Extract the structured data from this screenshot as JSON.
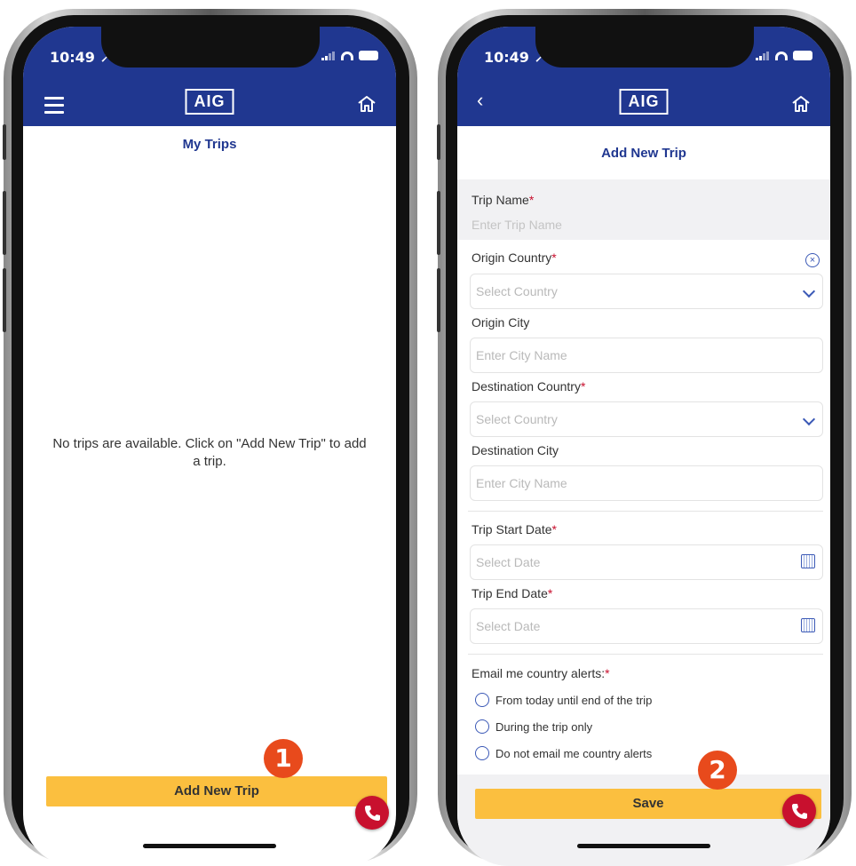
{
  "left_phone": {
    "status": {
      "time": "10:49 ➚"
    },
    "nav": {
      "logo": "AIG"
    },
    "title": "My Trips",
    "empty_message": "No trips are available. Click on \"Add New Trip\" to add a trip.",
    "add_button": "Add New Trip",
    "step_badge": "1"
  },
  "right_phone": {
    "status": {
      "time": "10:49 ➚"
    },
    "nav": {
      "back": "‹",
      "logo": "AIG"
    },
    "title": "Add New Trip",
    "required_mark": "*",
    "form": {
      "trip_name_label": "Trip Name",
      "trip_name_placeholder": "Enter Trip Name",
      "origin_country_label": "Origin Country",
      "origin_country_placeholder": "Select Country",
      "origin_city_label": "Origin City",
      "origin_city_placeholder": "Enter City Name",
      "destination_country_label": "Destination Country",
      "destination_country_placeholder": "Select Country",
      "destination_city_label": "Destination City",
      "destination_city_placeholder": "Enter City Name",
      "start_date_label": "Trip Start Date",
      "start_date_placeholder": "Select Date",
      "end_date_label": "Trip End Date",
      "end_date_placeholder": "Select Date",
      "alerts_label": "Email me country alerts:",
      "alert_options": [
        "From today until end of the trip",
        "During the trip only",
        "Do not email me country alerts"
      ]
    },
    "save_button": "Save",
    "step_badge": "2"
  },
  "colors": {
    "nav": "#203790",
    "accent_button": "#fbbf3f",
    "call_button": "#c8102e",
    "badge": "#e84a1c",
    "required": "#c8102e"
  },
  "icons": [
    "hamburger-menu-icon",
    "home-icon",
    "back-chevron-icon",
    "phone-icon",
    "clear-circle-icon",
    "chevron-down-icon",
    "calendar-icon"
  ]
}
